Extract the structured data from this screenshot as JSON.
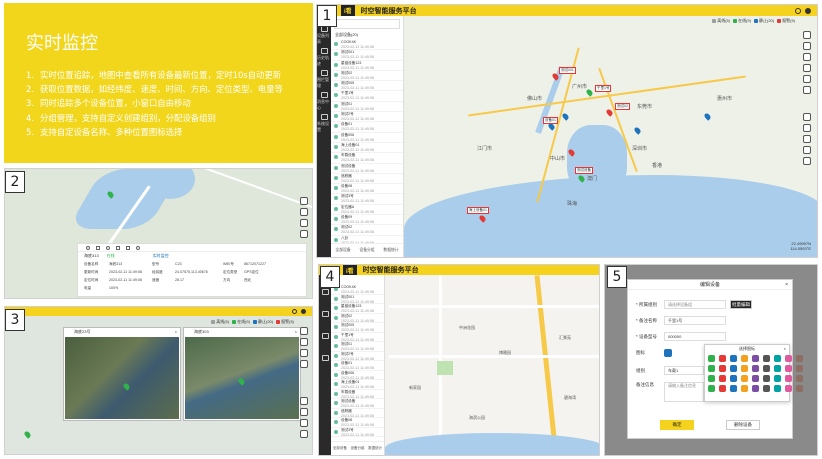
{
  "intro": {
    "title": "实时监控",
    "items": [
      "实时位置追踪，地图中查看所有设备最新位置，定时10s自动更新",
      "获取位置数据，如经纬度、速度、时间、方向、定位类型、电量等",
      "同时追踪多个设备位置，小窗口自由移动",
      "分组管理，支持自定义创建组别，分配设备组别",
      "支持自定设备名称、多种位置图标选择"
    ],
    "numbers": [
      "1.",
      "2.",
      "3.",
      "4.",
      "5."
    ]
  },
  "badges": [
    "1",
    "2",
    "3",
    "4",
    "5"
  ],
  "app": {
    "title": "时空智能服务平台",
    "logo": "i看",
    "legend": [
      "离线(5)",
      "在线(9)",
      "静止(20)",
      "报警(5)"
    ],
    "sidebar": [
      "设备列表",
      "历史轨迹",
      "围栏管理",
      "消息中心",
      "系统设置"
    ],
    "list_header": "全部设备(20)",
    "devices": [
      {
        "name": "COOK4K",
        "time": "2023-02-11 11:49:08"
      },
      {
        "name": "测试001",
        "time": "2023-02-11 11:49:08"
      },
      {
        "name": "星链设备123",
        "time": "2023-02-11 11:49:08"
      },
      {
        "name": "测试02",
        "time": "2023-02-11 11:49:08"
      },
      {
        "name": "测试005",
        "time": "2023-02-11 11:49:08"
      },
      {
        "name": "千里1号",
        "time": "2023-02-11 11:49:08"
      },
      {
        "name": "测试01",
        "time": "2023-02-11 11:49:08"
      },
      {
        "name": "测试2号",
        "time": "2023-02-11 11:49:08"
      },
      {
        "name": "设备01",
        "time": "2023-02-11 11:49:08"
      },
      {
        "name": "设备006",
        "time": "2023-02-11 11:49:08"
      },
      {
        "name": "海上设备01",
        "time": "2023-02-11 11:49:08"
      },
      {
        "name": "车载设备",
        "time": "2023-02-11 11:49:08"
      },
      {
        "name": "测试设备",
        "time": "2023-02-11 11:49:08"
      },
      {
        "name": "追踪器",
        "time": "2023-02-11 11:49:08"
      },
      {
        "name": "设备08",
        "time": "2023-02-11 11:49:08"
      },
      {
        "name": "测试3号",
        "time": "2023-02-11 11:49:08"
      },
      {
        "name": "定位器A",
        "time": "2023-02-11 11:49:08"
      },
      {
        "name": "设备09",
        "time": "2023-02-11 11:49:08"
      },
      {
        "name": "测试02",
        "time": "2023-02-11 11:49:08"
      },
      {
        "name": "八卦",
        "time": "2023-02-11 11:49:08"
      }
    ],
    "bottom_tabs": [
      "全部设备",
      "设备分组",
      "数据统计"
    ],
    "scale": [
      "22.49997N",
      "114.0593°E"
    ],
    "cities": [
      "广州市",
      "东莞市",
      "深圳市",
      "香港",
      "珠海",
      "中山市",
      "佛山市",
      "江门市",
      "惠州市",
      "澳门"
    ]
  },
  "panel2": {
    "info": {
      "device": "海底313",
      "status": "在线",
      "tab": "实时监控",
      "labels": [
        "设备名称",
        "型号",
        "IMEI号",
        "更新时间",
        "经纬度",
        "定位类型",
        "定位时间",
        "速度",
        "方向",
        "电量"
      ],
      "values": [
        "海底313",
        "C23",
        "86712071227",
        "2023-02-11 11:49:08",
        "24.07575,113.40676",
        "GPS定位",
        "2023-02-11 11:49:08",
        "28.17",
        "西北",
        "100%"
      ]
    }
  },
  "panel3": {
    "win1": "海底23号",
    "win2": "海底303"
  },
  "panel4": {
    "places": [
      "中洲花园",
      "博雅园",
      "新家园",
      "海滨公园",
      "汇景苑",
      "碧海湾"
    ]
  },
  "panel5": {
    "title": "编辑设备",
    "labels": [
      "* 所属组别",
      "* 备注名称",
      "* 设备型号",
      "图标",
      "组别",
      "备注信息"
    ],
    "values": [
      "请选择设备组",
      "千里1号",
      "000000",
      "",
      "车载1",
      ""
    ],
    "placeholder_note": "请输入备注信息",
    "batch_button": "批量编辑",
    "icon_picker_title": "选择图标",
    "confirm": "确定",
    "cancel": "删除设备"
  },
  "colors": {
    "accent": "#f4d21e",
    "sidebar": "#2a2a2a",
    "online": "#2fb24c",
    "offline": "#9e9e9e",
    "alarm": "#e53935",
    "static": "#1e73be"
  }
}
